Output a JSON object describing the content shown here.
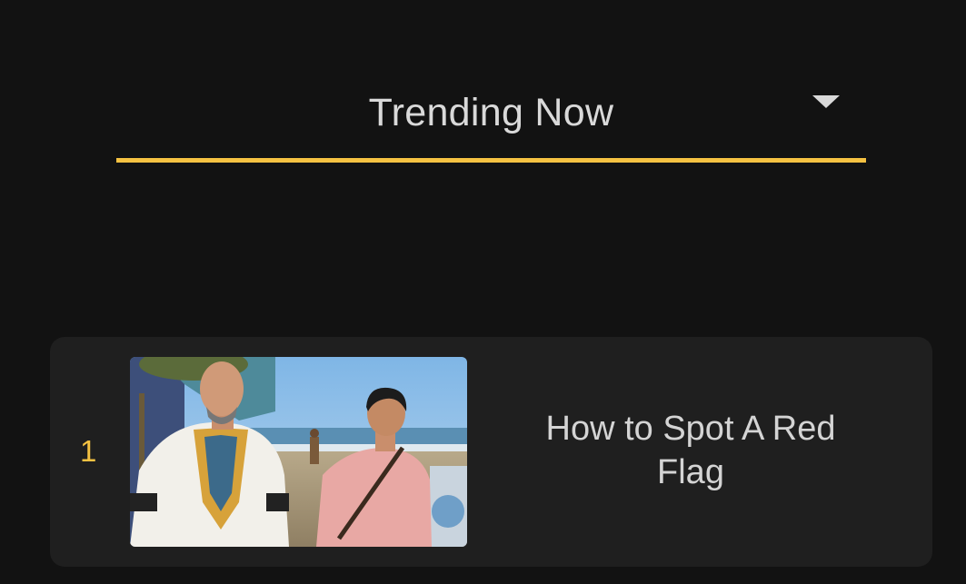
{
  "header": {
    "dropdown_label": "Trending Now",
    "caret_icon": "chevron-down-icon",
    "underline_color": "#f5c242"
  },
  "list": {
    "items": [
      {
        "rank": "1",
        "title": "How to Spot A Red Flag",
        "thumbnail_icon": "movie-still-thumbnail"
      }
    ]
  },
  "colors": {
    "background": "#121212",
    "card": "#1f1f1f",
    "accent": "#f5c242",
    "text": "#d9d9d9"
  }
}
